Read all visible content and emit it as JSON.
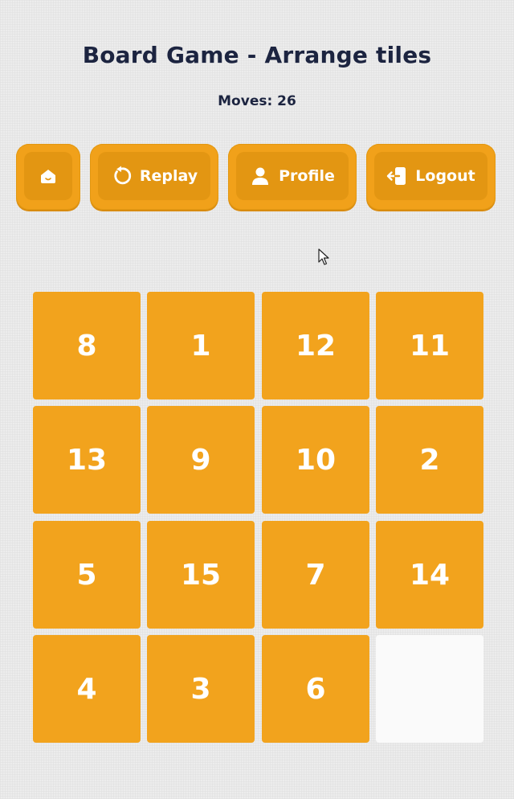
{
  "header": {
    "title": "Board Game - Arrange tiles",
    "moves_label": "Moves: 26"
  },
  "toolbar": {
    "home_icon": "home-icon",
    "replay_icon": "replay-icon",
    "replay_label": "Replay",
    "profile_icon": "user-icon",
    "profile_label": "Profile",
    "logout_icon": "logout-icon",
    "logout_label": "Logout"
  },
  "colors": {
    "tile": "#f2a31d",
    "button": "#f1a11a",
    "button_inner": "#e39612",
    "empty_tile": "#fafafa",
    "text_dark": "#1c2440"
  },
  "board": {
    "size": 4,
    "tiles": [
      "8",
      "1",
      "12",
      "11",
      "13",
      "9",
      "10",
      "2",
      "5",
      "15",
      "7",
      "14",
      "4",
      "3",
      "6",
      ""
    ]
  }
}
